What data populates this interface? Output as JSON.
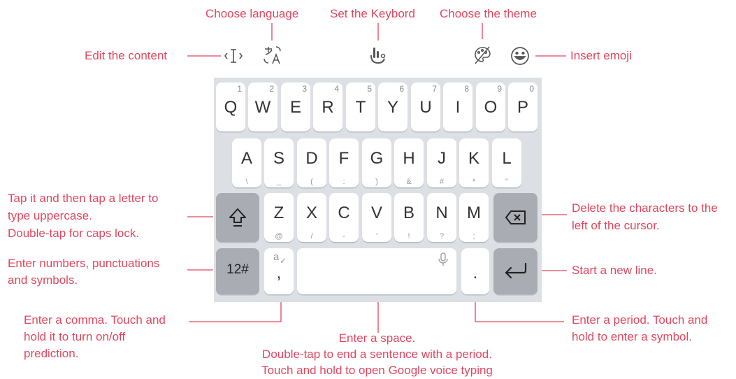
{
  "annotations": {
    "choose_language": "Choose language",
    "set_keyboard": "Set the Keybord",
    "choose_theme": "Choose the theme",
    "edit_content": "Edit the content",
    "insert_emoji": "Insert emoji",
    "shift_line1": "Tap it and then tap a letter to",
    "shift_line2": "type uppercase.",
    "shift_line3": "Double-tap for caps lock.",
    "numbers_line1": "Enter numbers, punctuations",
    "numbers_line2": "and symbols.",
    "comma_line1": "Enter a comma. Touch and",
    "comma_line2": "hold it to turn on/off",
    "comma_line3": "prediction.",
    "space_line1": "Enter a space.",
    "space_line2": "Double-tap to end a sentence with a period.",
    "space_line3": "Touch and hold to open Google voice typing",
    "delete_line1": "Delete the characters to the",
    "delete_line2": "left of the cursor.",
    "newline": "Start a new line.",
    "period_line1": "Enter a period. Touch and",
    "period_line2": "hold to enter a symbol."
  },
  "toolbar_icons": [
    "text-cursor-icon",
    "translate-icon",
    "keyboard-settings-icon",
    "palette-icon",
    "emoji-icon"
  ],
  "keyboard": {
    "row1": [
      {
        "label": "Q",
        "hint": "1"
      },
      {
        "label": "W",
        "hint": "2"
      },
      {
        "label": "E",
        "hint": "3"
      },
      {
        "label": "R",
        "hint": "4"
      },
      {
        "label": "T",
        "hint": "5"
      },
      {
        "label": "Y",
        "hint": "6"
      },
      {
        "label": "U",
        "hint": "7"
      },
      {
        "label": "I",
        "hint": "8"
      },
      {
        "label": "O",
        "hint": "9"
      },
      {
        "label": "P",
        "hint": "0"
      }
    ],
    "row2": [
      {
        "label": "A",
        "sub": "\\"
      },
      {
        "label": "S",
        "sub": "_"
      },
      {
        "label": "D",
        "sub": "("
      },
      {
        "label": "F",
        "sub": ":"
      },
      {
        "label": "G",
        "sub": ")"
      },
      {
        "label": "H",
        "sub": "&"
      },
      {
        "label": "J",
        "sub": "#"
      },
      {
        "label": "K",
        "sub": "*"
      },
      {
        "label": "L",
        "sub": "\""
      }
    ],
    "row3": [
      {
        "label": "Z",
        "sub": "@"
      },
      {
        "label": "X",
        "sub": "/"
      },
      {
        "label": "C",
        "sub": "-"
      },
      {
        "label": "V",
        "sub": "'"
      },
      {
        "label": "B",
        "sub": "!"
      },
      {
        "label": "N",
        "sub": "?"
      },
      {
        "label": "M",
        "sub": ";"
      }
    ],
    "numbers_key": "12#",
    "comma_key": ",",
    "comma_hint": "a",
    "period_key": "."
  },
  "colors": {
    "annotation": "#e0475f",
    "keyboard_bg": "#dcdfe3",
    "key": "#ffffff",
    "dark_key": "#a9acb2"
  }
}
